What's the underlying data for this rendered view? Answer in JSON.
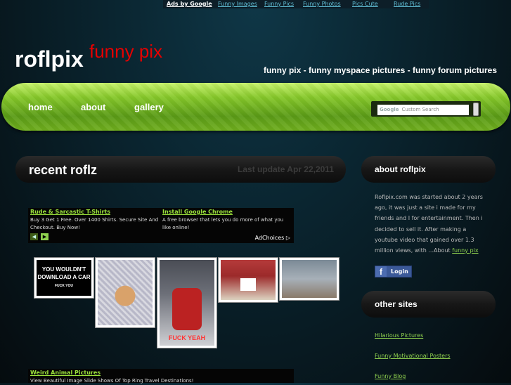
{
  "top_ads": {
    "label": "Ads by Google",
    "links": [
      "Funny Images",
      "Funny Pics",
      "Funny Photos",
      "Pics Cute",
      "Rude Pics"
    ]
  },
  "header": {
    "logo": "roflpix",
    "logo_sub": "funny pix",
    "tagline": "funny pix - funny myspace pictures - funny forum pictures"
  },
  "nav": {
    "items": [
      "home",
      "about",
      "gallery"
    ],
    "search_placeholder": "Custom Search",
    "search_brand": "Google"
  },
  "main": {
    "title": "recent roflz",
    "last_update": "Last update Apr 22,2011",
    "ad_top": {
      "items": [
        {
          "title": "Rude & Sarcastic T-Shirts",
          "desc": "Buy 3 Get 1 Free. Over 1400 Shirts. Secure Site And Checkout. Buy Now!"
        },
        {
          "title": "Install Google Chrome",
          "desc": "A free browser that lets you do more of what you like online!"
        }
      ],
      "adchoices": "AdChoices ▷",
      "prev": "◀",
      "next": "▶"
    },
    "thumbs": [
      {
        "caption": "YOU WOULDN'T DOWNLOAD A CAR",
        "sub": "FUCK YOU"
      },
      {
        "caption": ""
      },
      {
        "caption": "FUCK YEAH"
      },
      {
        "caption": ""
      },
      {
        "caption": ""
      }
    ],
    "ad_bottom": {
      "title": "Weird Animal Pictures",
      "desc": "View Beautiful Image Slide Shows Of Top Ring Travel Destinations!"
    }
  },
  "sidebar": {
    "about_title": "about roflpix",
    "about_text": "Roflpix.com was started about 2 years ago, it was just a site i made for my friends and I for entertainment. Then i decided to sell it. After making a youtube video that gained over 1.3 million views, with ...About",
    "about_link": "funny pix",
    "login_label": "Login",
    "other_title": "other sites",
    "other_links": [
      "Hilarious Pictures",
      "Funny Motivational Posters",
      "Funny Blog"
    ]
  },
  "colors": {
    "accent_green": "#8fd14f",
    "logo_red": "#e60000",
    "nav_green": "#86c82a"
  }
}
